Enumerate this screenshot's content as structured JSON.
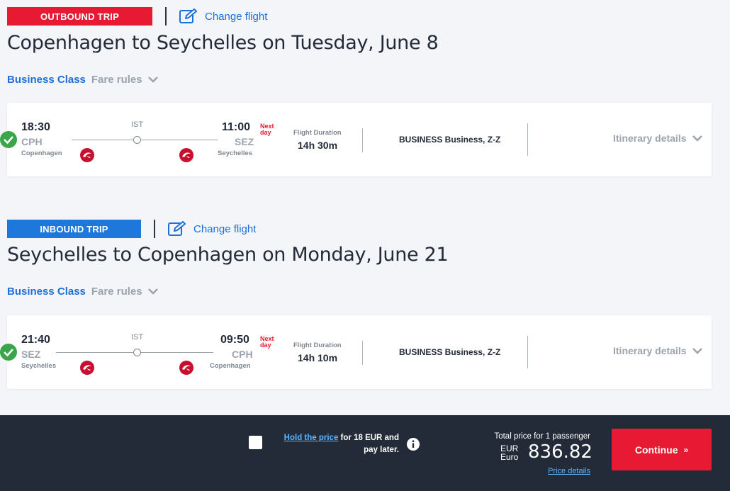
{
  "outbound": {
    "badge": "OUTBOUND TRIP",
    "change_label": "Change flight",
    "title": "Copenhagen to Seychelles on Tuesday, June 8",
    "class_name": "Business Class",
    "fare_rules": "Fare rules",
    "flight": {
      "dep_time": "18:30",
      "dep_code": "CPH",
      "dep_city": "Copenhagen",
      "stop": "IST",
      "arr_time": "11:00",
      "arr_code": "SEZ",
      "arr_city": "Seychelles",
      "next_day_1": "Next",
      "next_day_2": "day",
      "duration_label": "Flight Duration",
      "duration": "14h 30m",
      "cabin": "BUSINESS Business, Z-Z",
      "itinerary": "Itinerary details"
    }
  },
  "inbound": {
    "badge": "INBOUND TRIP",
    "change_label": "Change flight",
    "title": "Seychelles to Copenhagen on Monday, June 21",
    "class_name": "Business Class",
    "fare_rules": "Fare rules",
    "flight": {
      "dep_time": "21:40",
      "dep_code": "SEZ",
      "dep_city": "Seychelles",
      "stop": "IST",
      "arr_time": "09:50",
      "arr_code": "CPH",
      "arr_city": "Copenhagen",
      "next_day_1": "Next",
      "next_day_2": "day",
      "duration_label": "Flight Duration",
      "duration": "14h 10m",
      "cabin": "BUSINESS Business, Z-Z",
      "itinerary": "Itinerary details"
    }
  },
  "footer": {
    "hold_link": "Hold the price",
    "hold_rest_1": " for 18 EUR and",
    "hold_rest_2": "pay later.",
    "total_label": "Total price for 1 passenger",
    "currency_code": "EUR",
    "currency_name": "Euro",
    "price": "836.82",
    "price_details": "Price details",
    "continue_label": "Continue"
  },
  "colors": {
    "brand_red": "#e81932",
    "brand_blue": "#1e78dc",
    "link_blue": "#1e6fd9",
    "footer_bg": "#232b38",
    "check_green": "#3aa54a"
  }
}
